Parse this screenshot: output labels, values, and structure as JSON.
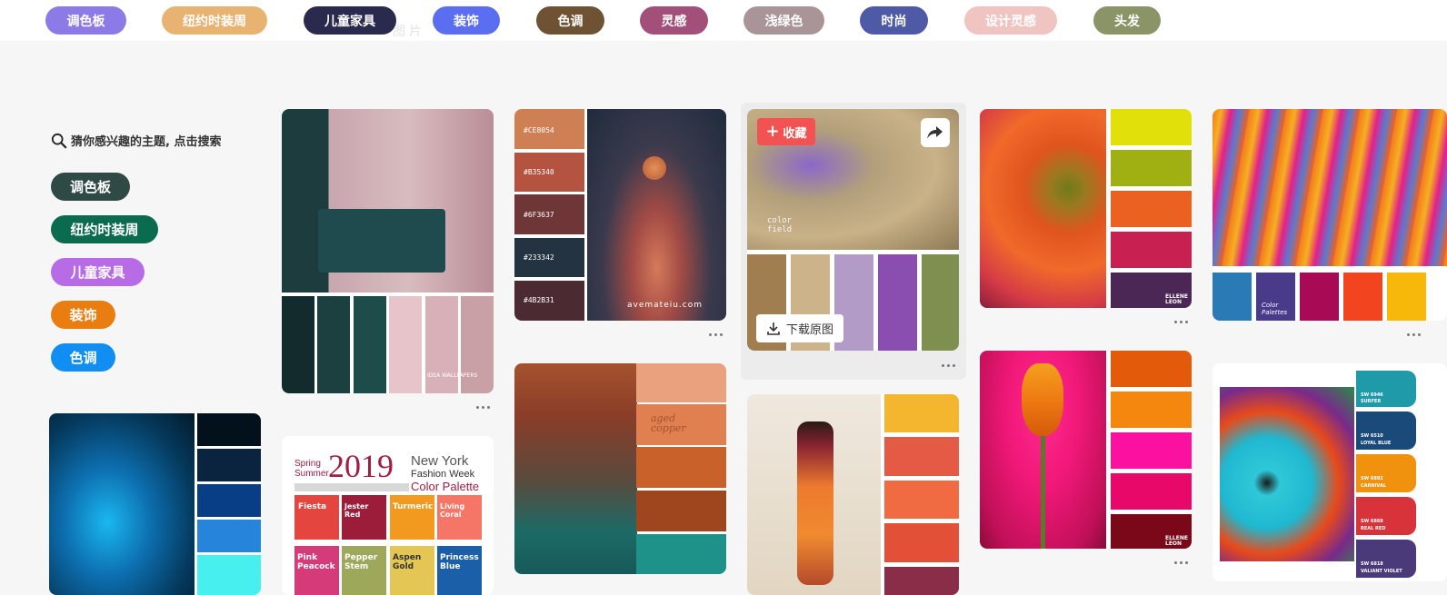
{
  "top_tags": [
    {
      "label": "调色板",
      "color": "#8c7ae6"
    },
    {
      "label": "纽约时装周",
      "color": "#e8b270"
    },
    {
      "label": "儿童家具",
      "color": "#2a2a4e"
    },
    {
      "label": "装饰",
      "color": "#5b6df0"
    },
    {
      "label": "色调",
      "color": "#6f5133"
    },
    {
      "label": "灵感",
      "color": "#a24f7a"
    },
    {
      "label": "浅绿色",
      "color": "#a99597"
    },
    {
      "label": "时尚",
      "color": "#4f5aa7"
    },
    {
      "label": "设计灵感",
      "color": "#f0c4c0"
    },
    {
      "label": "头发",
      "color": "#8a9467"
    }
  ],
  "sidebar": {
    "hint": "猜你感兴趣的主题, 点击搜索",
    "tags": [
      {
        "label": "调色板",
        "color": "#2f4a44"
      },
      {
        "label": "纽约时装周",
        "color": "#0b6b4f"
      },
      {
        "label": "儿童家具",
        "color": "#b86be6"
      },
      {
        "label": "装饰",
        "color": "#ea7d0f"
      },
      {
        "label": "色调",
        "color": "#118ef2"
      }
    ]
  },
  "cards": {
    "moon_palette": {
      "codes": [
        "#CE8054",
        "#B35340",
        "#6F3637",
        "#233342",
        "#4B2B31"
      ],
      "credit": "avemateiu.com"
    },
    "bedroom_palette": {
      "tag": "IDEA WALLPAPERS"
    },
    "hover_card": {
      "collect": "收藏",
      "download": "下载原图",
      "overlay_text": "color field"
    },
    "copper_card": {
      "text": "aged copper"
    },
    "flower_palette": {
      "brand": "ELLENE LEON"
    },
    "tulip_palette": {
      "brand": "ELLENE LEON"
    },
    "rings_palette": {
      "brand": "Color Palettes"
    },
    "poster": {
      "season": "Spring Summer",
      "year": "2019",
      "title1": "New York",
      "title2": "Fashion Week",
      "title3": "Color Palette",
      "colors": [
        "Fiesta",
        "Jester Red",
        "Turmeric",
        "Living Coral",
        "Pink Peacock",
        "Pepper Stem",
        "Aspen Gold",
        "Princess Blue"
      ]
    },
    "daisy_palette": {
      "swatches": [
        {
          "code": "SW 6946",
          "name": "SURFER"
        },
        {
          "code": "SW 6510",
          "name": "LOYAL BLUE"
        },
        {
          "code": "SW 6892",
          "name": "CARNIVAL"
        },
        {
          "code": "SW 6868",
          "name": "REAL RED"
        },
        {
          "code": "SW 6818",
          "name": "VALIANT VIOLET"
        }
      ]
    }
  }
}
